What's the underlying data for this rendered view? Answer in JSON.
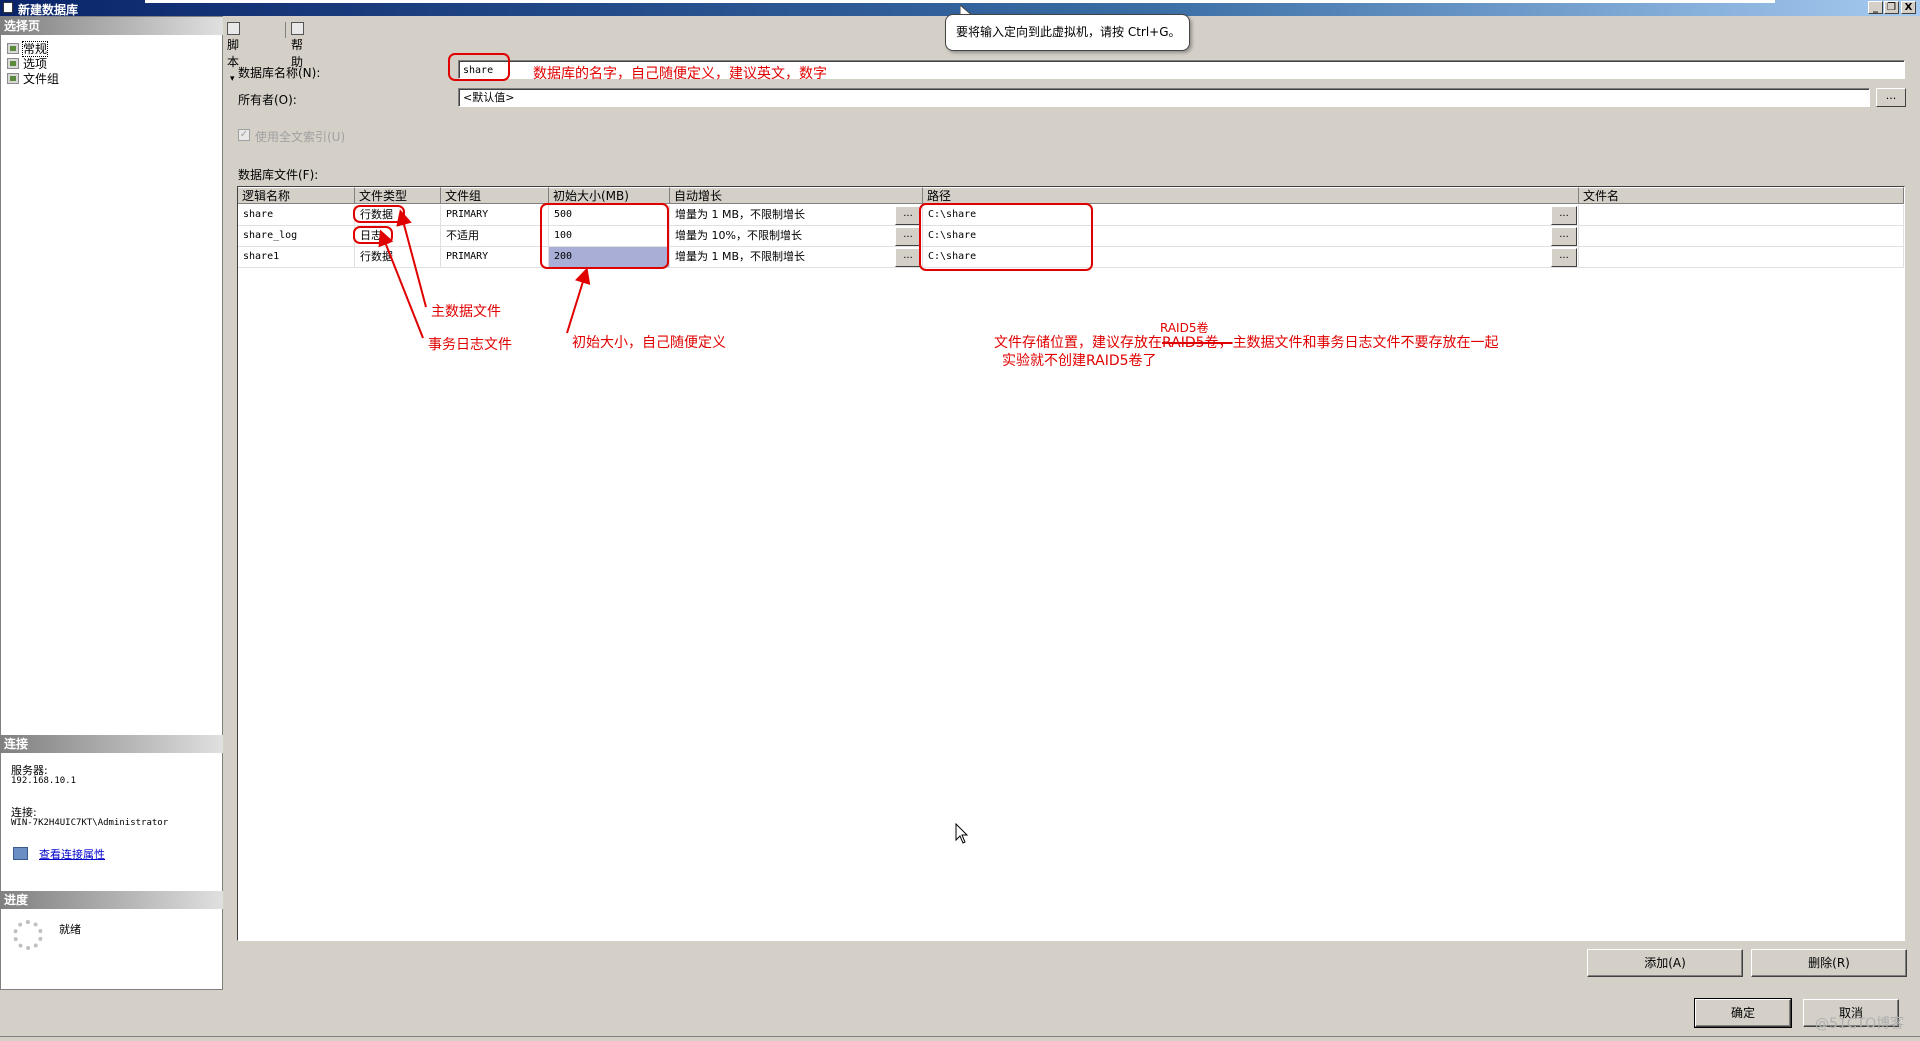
{
  "window": {
    "title": "新建数据库",
    "buttons": [
      "_",
      "❐",
      "X"
    ]
  },
  "left": {
    "select_page_header": "选择页",
    "pages": [
      {
        "label": "常规"
      },
      {
        "label": "选项"
      },
      {
        "label": "文件组"
      }
    ],
    "connection_header": "连接",
    "server_label": "服务器:",
    "server_value": "192.168.10.1",
    "connection_label": "连接:",
    "connection_value": "WIN-7K2H4UIC7KT\\Administrator",
    "view_connection_link": "查看连接属性",
    "progress_header": "进度",
    "progress_status": "就绪"
  },
  "toolbar": {
    "script_label": "脚本",
    "dropdown": "▾",
    "help_label": "帮助"
  },
  "tooltip": {
    "text": "要将输入定向到此虚拟机，请按 Ctrl+G。"
  },
  "form": {
    "db_name_label": "数据库名称(N):",
    "db_name_value": "share",
    "owner_label": "所有者(O):",
    "owner_value": "<默认值>",
    "browse": "...",
    "fulltext_label": "使用全文索引(U)",
    "files_label": "数据库文件(F):"
  },
  "grid": {
    "columns": [
      "逻辑名称",
      "文件类型",
      "文件组",
      "初始大小(MB)",
      "自动增长",
      "路径",
      "文件名"
    ],
    "rows": [
      {
        "logical_name": "share",
        "file_type": "行数据",
        "filegroup": "PRIMARY",
        "initial_size": "500",
        "autogrowth": "增量为 1 MB，不限制增长",
        "path": "C:\\share",
        "filename": ""
      },
      {
        "logical_name": "share_log",
        "file_type": "日志",
        "filegroup": "不适用",
        "initial_size": "100",
        "autogrowth": "增量为 10%，不限制增长",
        "path": "C:\\share",
        "filename": ""
      },
      {
        "logical_name": "share1",
        "file_type": "行数据",
        "filegroup": "PRIMARY",
        "initial_size": "200",
        "autogrowth": "增量为 1 MB，不限制增长",
        "path": "C:\\share",
        "filename": ""
      }
    ],
    "cell_button": "..."
  },
  "buttons": {
    "add": "添加(A)",
    "remove": "删除(R)",
    "ok": "确定",
    "cancel": "取消"
  },
  "annotations": {
    "db_name_note": "数据库的名字，自己随便定义，建议英文，数字",
    "primary_data_file": "主数据文件",
    "transaction_log_file": "事务日志文件",
    "initial_size_note": "初始大小，自己随便定义",
    "path_note_raid": "RAID5卷",
    "path_note_line1_a": "文件存储位置，建议存放在",
    "path_note_struck": "RAID5卷，",
    "path_note_line1_b": "主数据文件和事务日志文件不要存放在一起",
    "path_note_line2": "实验就不创建RAID5卷了",
    "color": "#e00000"
  },
  "watermark": "@51CTO博客"
}
